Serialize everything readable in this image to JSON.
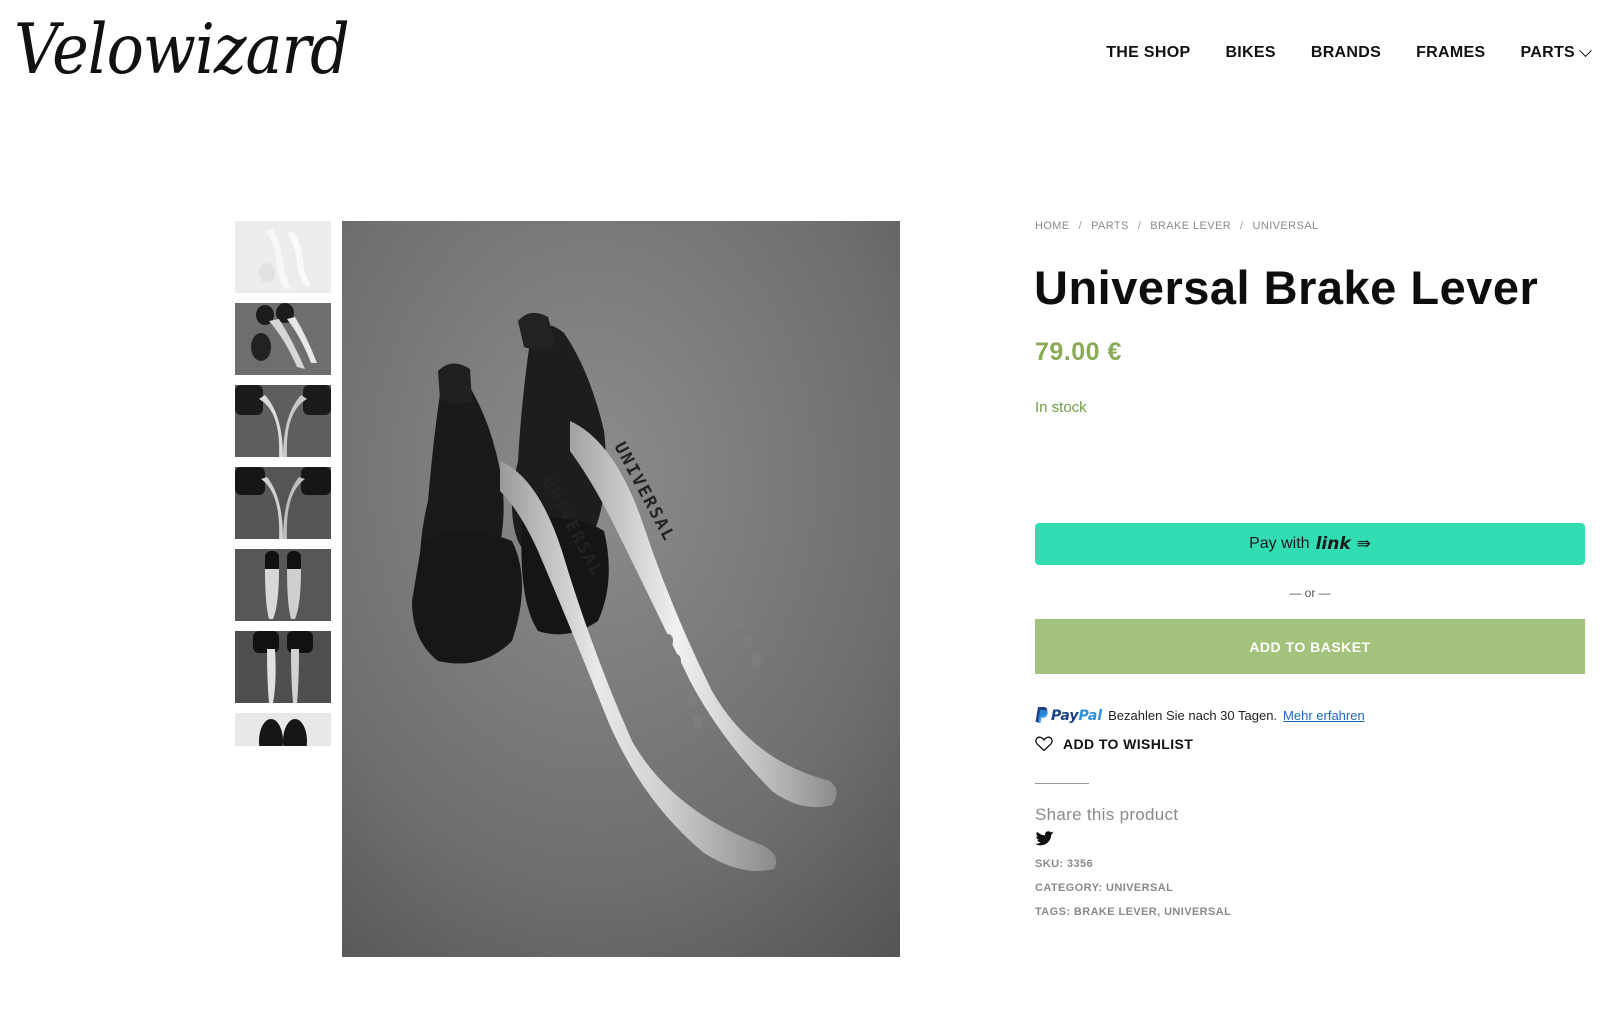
{
  "header": {
    "logo_text": "Velowizard",
    "nav": [
      {
        "label": "THE SHOP"
      },
      {
        "label": "BIKES"
      },
      {
        "label": "BRANDS"
      },
      {
        "label": "FRAMES"
      },
      {
        "label": "PARTS",
        "has_dropdown": true
      }
    ]
  },
  "gallery": {
    "thumbnail_count": 7,
    "main_image_alt": "Pair of silver Universal brake levers with black rubber hoods on grey background",
    "lever_text": "UNIVERSAL"
  },
  "product": {
    "breadcrumbs": [
      "HOME",
      "PARTS",
      "BRAKE LEVER",
      "UNIVERSAL"
    ],
    "breadcrumb_separator": "/",
    "title": "Universal Brake Lever",
    "price": "79.00 €",
    "stock": "In stock",
    "pay_with_label": "Pay with",
    "pay_link_brand": "link",
    "or_label": "— or —",
    "add_to_basket": "ADD TO BASKET",
    "paypal_brand_pay": "Pay",
    "paypal_brand_pal": "Pal",
    "paypal_text": "Bezahlen Sie nach 30 Tagen.",
    "paypal_link": "Mehr erfahren",
    "wishlist": "ADD TO WISHLIST",
    "share_title": "Share this product",
    "sku_label": "SKU:",
    "sku_value": "3356",
    "category_label": "CATEGORY:",
    "category_value": "UNIVERSAL",
    "tags_label": "TAGS:",
    "tags": [
      "BRAKE LEVER",
      "UNIVERSAL"
    ]
  },
  "colors": {
    "price": "#8aab57",
    "stock": "#6f9f4a",
    "link_button": "#33ddb3",
    "basket_button": "#a3c27c",
    "muted_text": "#8a8a8a"
  },
  "icons": {
    "nav_dropdown": "chevron-down-icon",
    "wishlist": "heart-icon",
    "share": "twitter-icon",
    "paypal": "paypal-logo",
    "link_arrow": "arrow-icon"
  }
}
